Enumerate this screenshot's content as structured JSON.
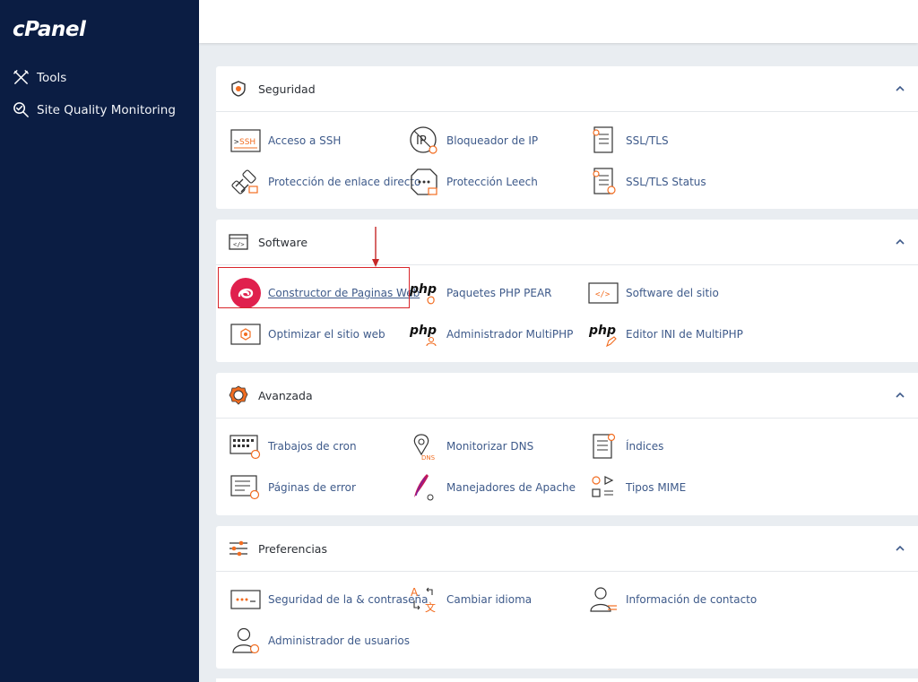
{
  "sidebar": {
    "logo": "cPanel",
    "items": [
      {
        "label": "Tools",
        "icon": "tools-icon"
      },
      {
        "label": "Site Quality Monitoring",
        "icon": "site-quality-icon"
      }
    ]
  },
  "sections": [
    {
      "title": "Seguridad",
      "icon": "shield-icon",
      "items": [
        {
          "label": "Acceso a SSH",
          "icon": "ssh-icon"
        },
        {
          "label": "Bloqueador de IP",
          "icon": "ip-blocker-icon"
        },
        {
          "label": "SSL/TLS",
          "icon": "ssl-tls-icon"
        },
        {
          "label": "Protección de enlace directo",
          "icon": "hotlink-protection-icon"
        },
        {
          "label": "Protección Leech",
          "icon": "leech-protection-icon"
        },
        {
          "label": "SSL/TLS Status",
          "icon": "ssl-status-icon"
        }
      ]
    },
    {
      "title": "Software",
      "icon": "code-window-icon",
      "items": [
        {
          "label": "Constructor de Paginas Web",
          "icon": "site-builder-icon"
        },
        {
          "label": "Paquetes PHP PEAR",
          "icon": "php-pear-icon"
        },
        {
          "label": "Software del sitio",
          "icon": "site-software-icon"
        },
        {
          "label": "Optimizar el sitio web",
          "icon": "optimize-icon"
        },
        {
          "label": "Administrador MultiPHP",
          "icon": "multiphp-manager-icon"
        },
        {
          "label": "Editor INI de MultiPHP",
          "icon": "multiphp-ini-icon"
        }
      ]
    },
    {
      "title": "Avanzada",
      "icon": "gear-icon",
      "items": [
        {
          "label": "Trabajos de cron",
          "icon": "cron-icon"
        },
        {
          "label": "Monitorizar DNS",
          "icon": "dns-icon"
        },
        {
          "label": "Índices",
          "icon": "indexes-icon"
        },
        {
          "label": "Páginas de error",
          "icon": "error-pages-icon"
        },
        {
          "label": "Manejadores de Apache",
          "icon": "apache-icon"
        },
        {
          "label": "Tipos MIME",
          "icon": "mime-icon"
        }
      ]
    },
    {
      "title": "Preferencias",
      "icon": "sliders-icon",
      "items": [
        {
          "label": "Seguridad de la & contraseña",
          "icon": "password-icon"
        },
        {
          "label": "Cambiar idioma",
          "icon": "language-icon"
        },
        {
          "label": "Información de contacto",
          "icon": "contact-icon"
        },
        {
          "label": "Administrador de usuarios",
          "icon": "user-manager-icon"
        }
      ]
    }
  ],
  "colors": {
    "sidebar_bg": "#0b1d43",
    "link": "#3e5a8a",
    "accent": "#f26d21",
    "highlight": "#d9262b"
  }
}
